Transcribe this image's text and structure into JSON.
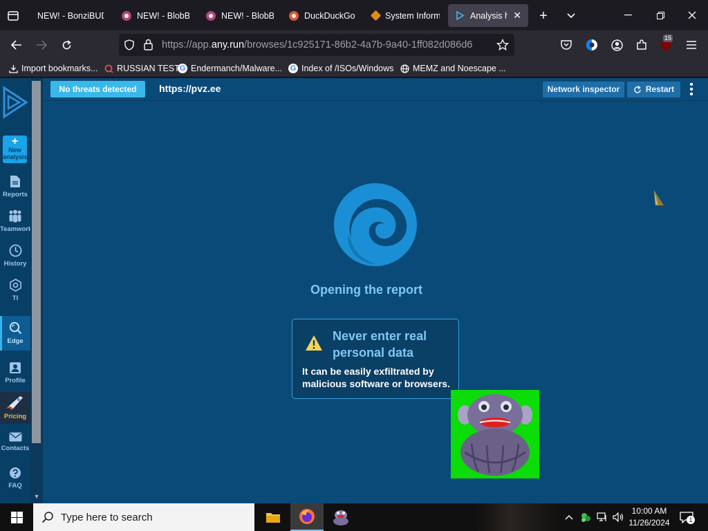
{
  "browser": {
    "tabs": [
      {
        "title": "NEW! - BonziBUDDY",
        "favicon": "none"
      },
      {
        "title": "NEW! - BlobBUDDY",
        "favicon": "blob-icon"
      },
      {
        "title": "NEW! - BlobBUDDY",
        "favicon": "blob-icon"
      },
      {
        "title": "DuckDuckGo",
        "favicon": "duckduckgo-icon"
      },
      {
        "title": "System Information",
        "favicon": "sysinfo-icon"
      },
      {
        "title": "Analysis https",
        "favicon": "anyrun-icon",
        "active": true
      }
    ],
    "url_prefix": "https://app.",
    "url_domain": "any.run",
    "url_path": "/browses/1c925171-86b2-4a7b-9a40-1ff082d086d6",
    "extension_badge": "15",
    "bookmarks": [
      {
        "label": "Import bookmarks...",
        "icon": "import-icon"
      },
      {
        "label": "RUSSIAN TEST",
        "icon": "search-icon"
      },
      {
        "label": "Endermanch/Malware...",
        "icon": "google-icon"
      },
      {
        "label": "Index of /ISOs/Windows",
        "icon": "google-icon"
      },
      {
        "label": "MEMZ and Noescape ...",
        "icon": "globe-icon"
      }
    ]
  },
  "app": {
    "threat_status": "No threats detected",
    "page_url": "https://pvz.ee",
    "network_inspector": "Network inspector",
    "restart": "Restart",
    "sidebar": {
      "new_analysis": "New analysis",
      "items": [
        {
          "label": "Reports"
        },
        {
          "label": "Teamwork"
        },
        {
          "label": "History"
        },
        {
          "label": "TI"
        },
        {
          "label": "Edge",
          "active": true
        },
        {
          "label": "Profile"
        },
        {
          "label": "Pricing"
        },
        {
          "label": "Contacts"
        },
        {
          "label": "FAQ"
        }
      ]
    },
    "opening_text": "Opening the report",
    "warning": {
      "title": "Never enter real personal data",
      "body": "It can be easily exfiltrated by malicious software or browsers."
    }
  },
  "taskbar": {
    "search_placeholder": "Type here to search",
    "time": "10:00 AM",
    "date": "11/26/2024",
    "notification_count": "1"
  },
  "colors": {
    "page_bg": "#0a4a78",
    "accent": "#3ab8ea",
    "edge_logo": "#1a8fd6"
  }
}
